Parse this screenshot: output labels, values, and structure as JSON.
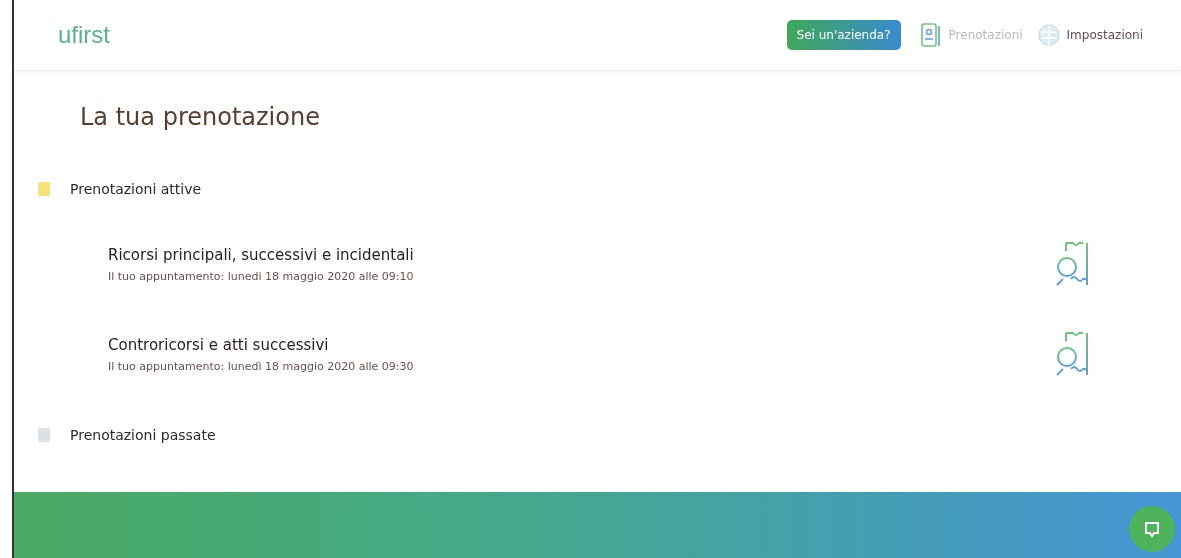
{
  "header": {
    "logo": "ufirst",
    "business_button": "Sei un'azienda?",
    "nav": [
      {
        "label": "Prenotazioni",
        "kind": "bookings",
        "selected": true
      },
      {
        "label": "Impostazioni",
        "kind": "settings",
        "selected": false
      }
    ]
  },
  "title": "La tua prenotazione",
  "sections": [
    {
      "title": "Prenotazioni attive",
      "kind": "active",
      "bookings": [
        {
          "name": "Ricorsi principali, successivi e incidentali",
          "appointment": "Il tuo appuntamento: lunedi 18 maggio 2020 alle 09:10"
        },
        {
          "name": "Controricorsi e atti successivi",
          "appointment": "Il tuo appuntamento: lunedì 18 maggio 2020 alle 09:30"
        }
      ]
    },
    {
      "title": "Prenotazioni passate",
      "kind": "past"
    }
  ]
}
